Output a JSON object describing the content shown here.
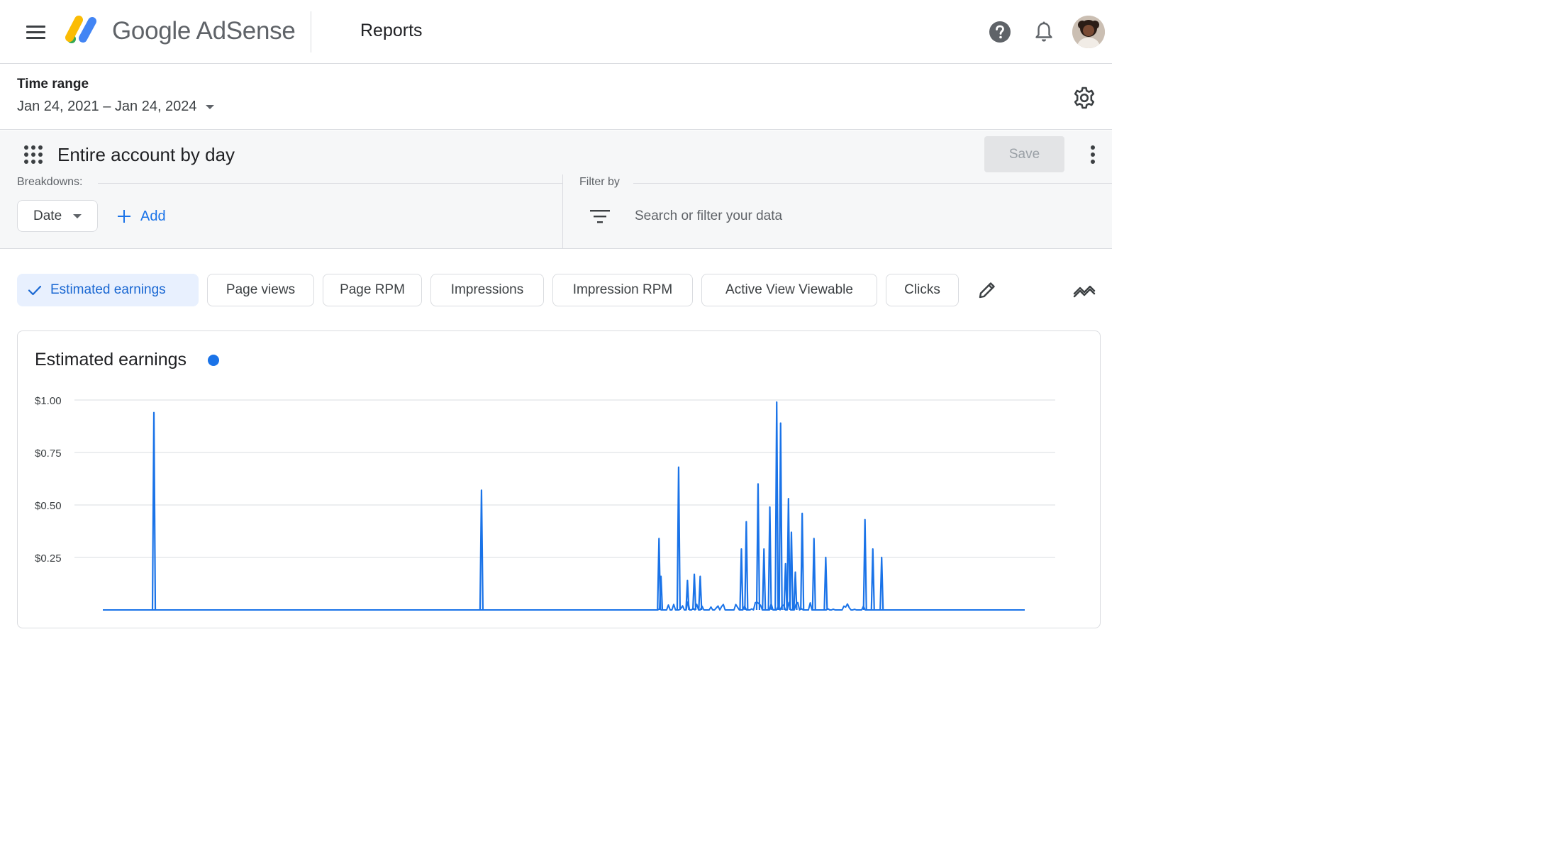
{
  "app": {
    "brand": "Google AdSense",
    "page_title": "Reports"
  },
  "header": {
    "menu_icon": "menu-icon",
    "help_icon": "help-circle-icon",
    "notifications_icon": "bell-icon",
    "avatar_icon": "account-avatar"
  },
  "time_range": {
    "label": "Time range",
    "value": "Jan 24, 2021 – Jan 24, 2024",
    "settings_icon": "gear-icon"
  },
  "report": {
    "title": "Entire account by day",
    "save_label": "Save",
    "breakdowns_label": "Breakdowns:",
    "breakdown_value": "Date",
    "add_label": "Add",
    "filter_label": "Filter by",
    "filter_placeholder": "Search or filter your data"
  },
  "metrics": [
    {
      "label": "Estimated earnings",
      "selected": true
    },
    {
      "label": "Page views",
      "selected": false
    },
    {
      "label": "Page RPM",
      "selected": false
    },
    {
      "label": "Impressions",
      "selected": false
    },
    {
      "label": "Impression RPM",
      "selected": false
    },
    {
      "label": "Active View Viewable",
      "selected": false
    },
    {
      "label": "Clicks",
      "selected": false
    }
  ],
  "colors": {
    "accent": "#1a73e8",
    "selected_chip_bg": "#e8f0fe",
    "selected_chip_text": "#1967d2"
  },
  "chart_data": {
    "type": "line",
    "title": "Estimated earnings",
    "y_tick_labels": [
      "$1.00",
      "$0.75",
      "$0.50",
      "$0.25"
    ],
    "ylim": [
      0,
      1.0
    ],
    "grid": true,
    "series": [
      {
        "name": "Estimated earnings",
        "color": "#1a73e8",
        "spikes": [
          {
            "x": 0.081,
            "value": 0.94
          },
          {
            "x": 0.415,
            "value": 0.57
          },
          {
            "x": 0.596,
            "value": 0.34
          },
          {
            "x": 0.598,
            "value": 0.16
          },
          {
            "x": 0.616,
            "value": 0.68
          },
          {
            "x": 0.625,
            "value": 0.14
          },
          {
            "x": 0.632,
            "value": 0.17
          },
          {
            "x": 0.638,
            "value": 0.16
          },
          {
            "x": 0.68,
            "value": 0.29
          },
          {
            "x": 0.685,
            "value": 0.42
          },
          {
            "x": 0.697,
            "value": 0.6
          },
          {
            "x": 0.703,
            "value": 0.29
          },
          {
            "x": 0.709,
            "value": 0.49
          },
          {
            "x": 0.716,
            "value": 0.99
          },
          {
            "x": 0.72,
            "value": 0.89
          },
          {
            "x": 0.725,
            "value": 0.22
          },
          {
            "x": 0.728,
            "value": 0.53
          },
          {
            "x": 0.731,
            "value": 0.37
          },
          {
            "x": 0.735,
            "value": 0.18
          },
          {
            "x": 0.742,
            "value": 0.46
          },
          {
            "x": 0.754,
            "value": 0.34
          },
          {
            "x": 0.766,
            "value": 0.25
          },
          {
            "x": 0.806,
            "value": 0.43
          },
          {
            "x": 0.814,
            "value": 0.29
          },
          {
            "x": 0.823,
            "value": 0.25
          }
        ]
      }
    ]
  }
}
